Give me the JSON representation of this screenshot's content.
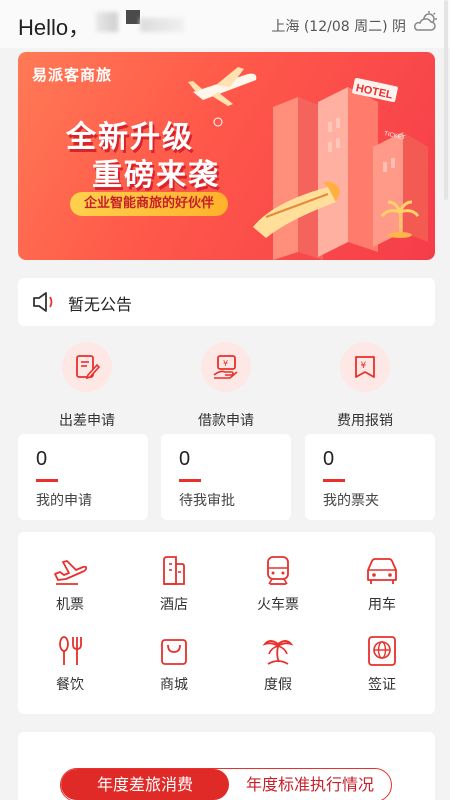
{
  "header": {
    "greeting": "Hello，",
    "location": "上海 (12/08 周二) 阴",
    "weather_icon": "cloudy-icon"
  },
  "banner": {
    "logo": "易派客商旅",
    "title_line1": "全新升级",
    "title_line2": "重磅来袭",
    "tagline": "企业智能商旅的好伙伴",
    "hotel_sign": "HOTEL",
    "ticket_sign": "TICKET"
  },
  "notice": {
    "text": "暂无公告",
    "icon": "speaker-icon"
  },
  "quick_actions": [
    {
      "label": "出差申请",
      "icon": "edit-form-icon"
    },
    {
      "label": "借款申请",
      "icon": "loan-icon"
    },
    {
      "label": "费用报销",
      "icon": "reimburse-icon"
    }
  ],
  "stats": [
    {
      "value": "0",
      "label": "我的申请"
    },
    {
      "value": "0",
      "label": "待我审批"
    },
    {
      "value": "0",
      "label": "我的票夹"
    }
  ],
  "services": [
    {
      "label": "机票",
      "icon": "plane-icon"
    },
    {
      "label": "酒店",
      "icon": "hotel-icon"
    },
    {
      "label": "火车票",
      "icon": "train-icon"
    },
    {
      "label": "用车",
      "icon": "car-icon"
    },
    {
      "label": "餐饮",
      "icon": "dining-icon"
    },
    {
      "label": "商城",
      "icon": "shopping-bag-icon"
    },
    {
      "label": "度假",
      "icon": "vacation-icon"
    },
    {
      "label": "签证",
      "icon": "visa-icon"
    }
  ],
  "bottom_tabs": {
    "active": "年度差旅消费",
    "inactive": "年度标准执行情况"
  },
  "colors": {
    "accent": "#e8302c",
    "icon_bg": "#fde8e6"
  }
}
